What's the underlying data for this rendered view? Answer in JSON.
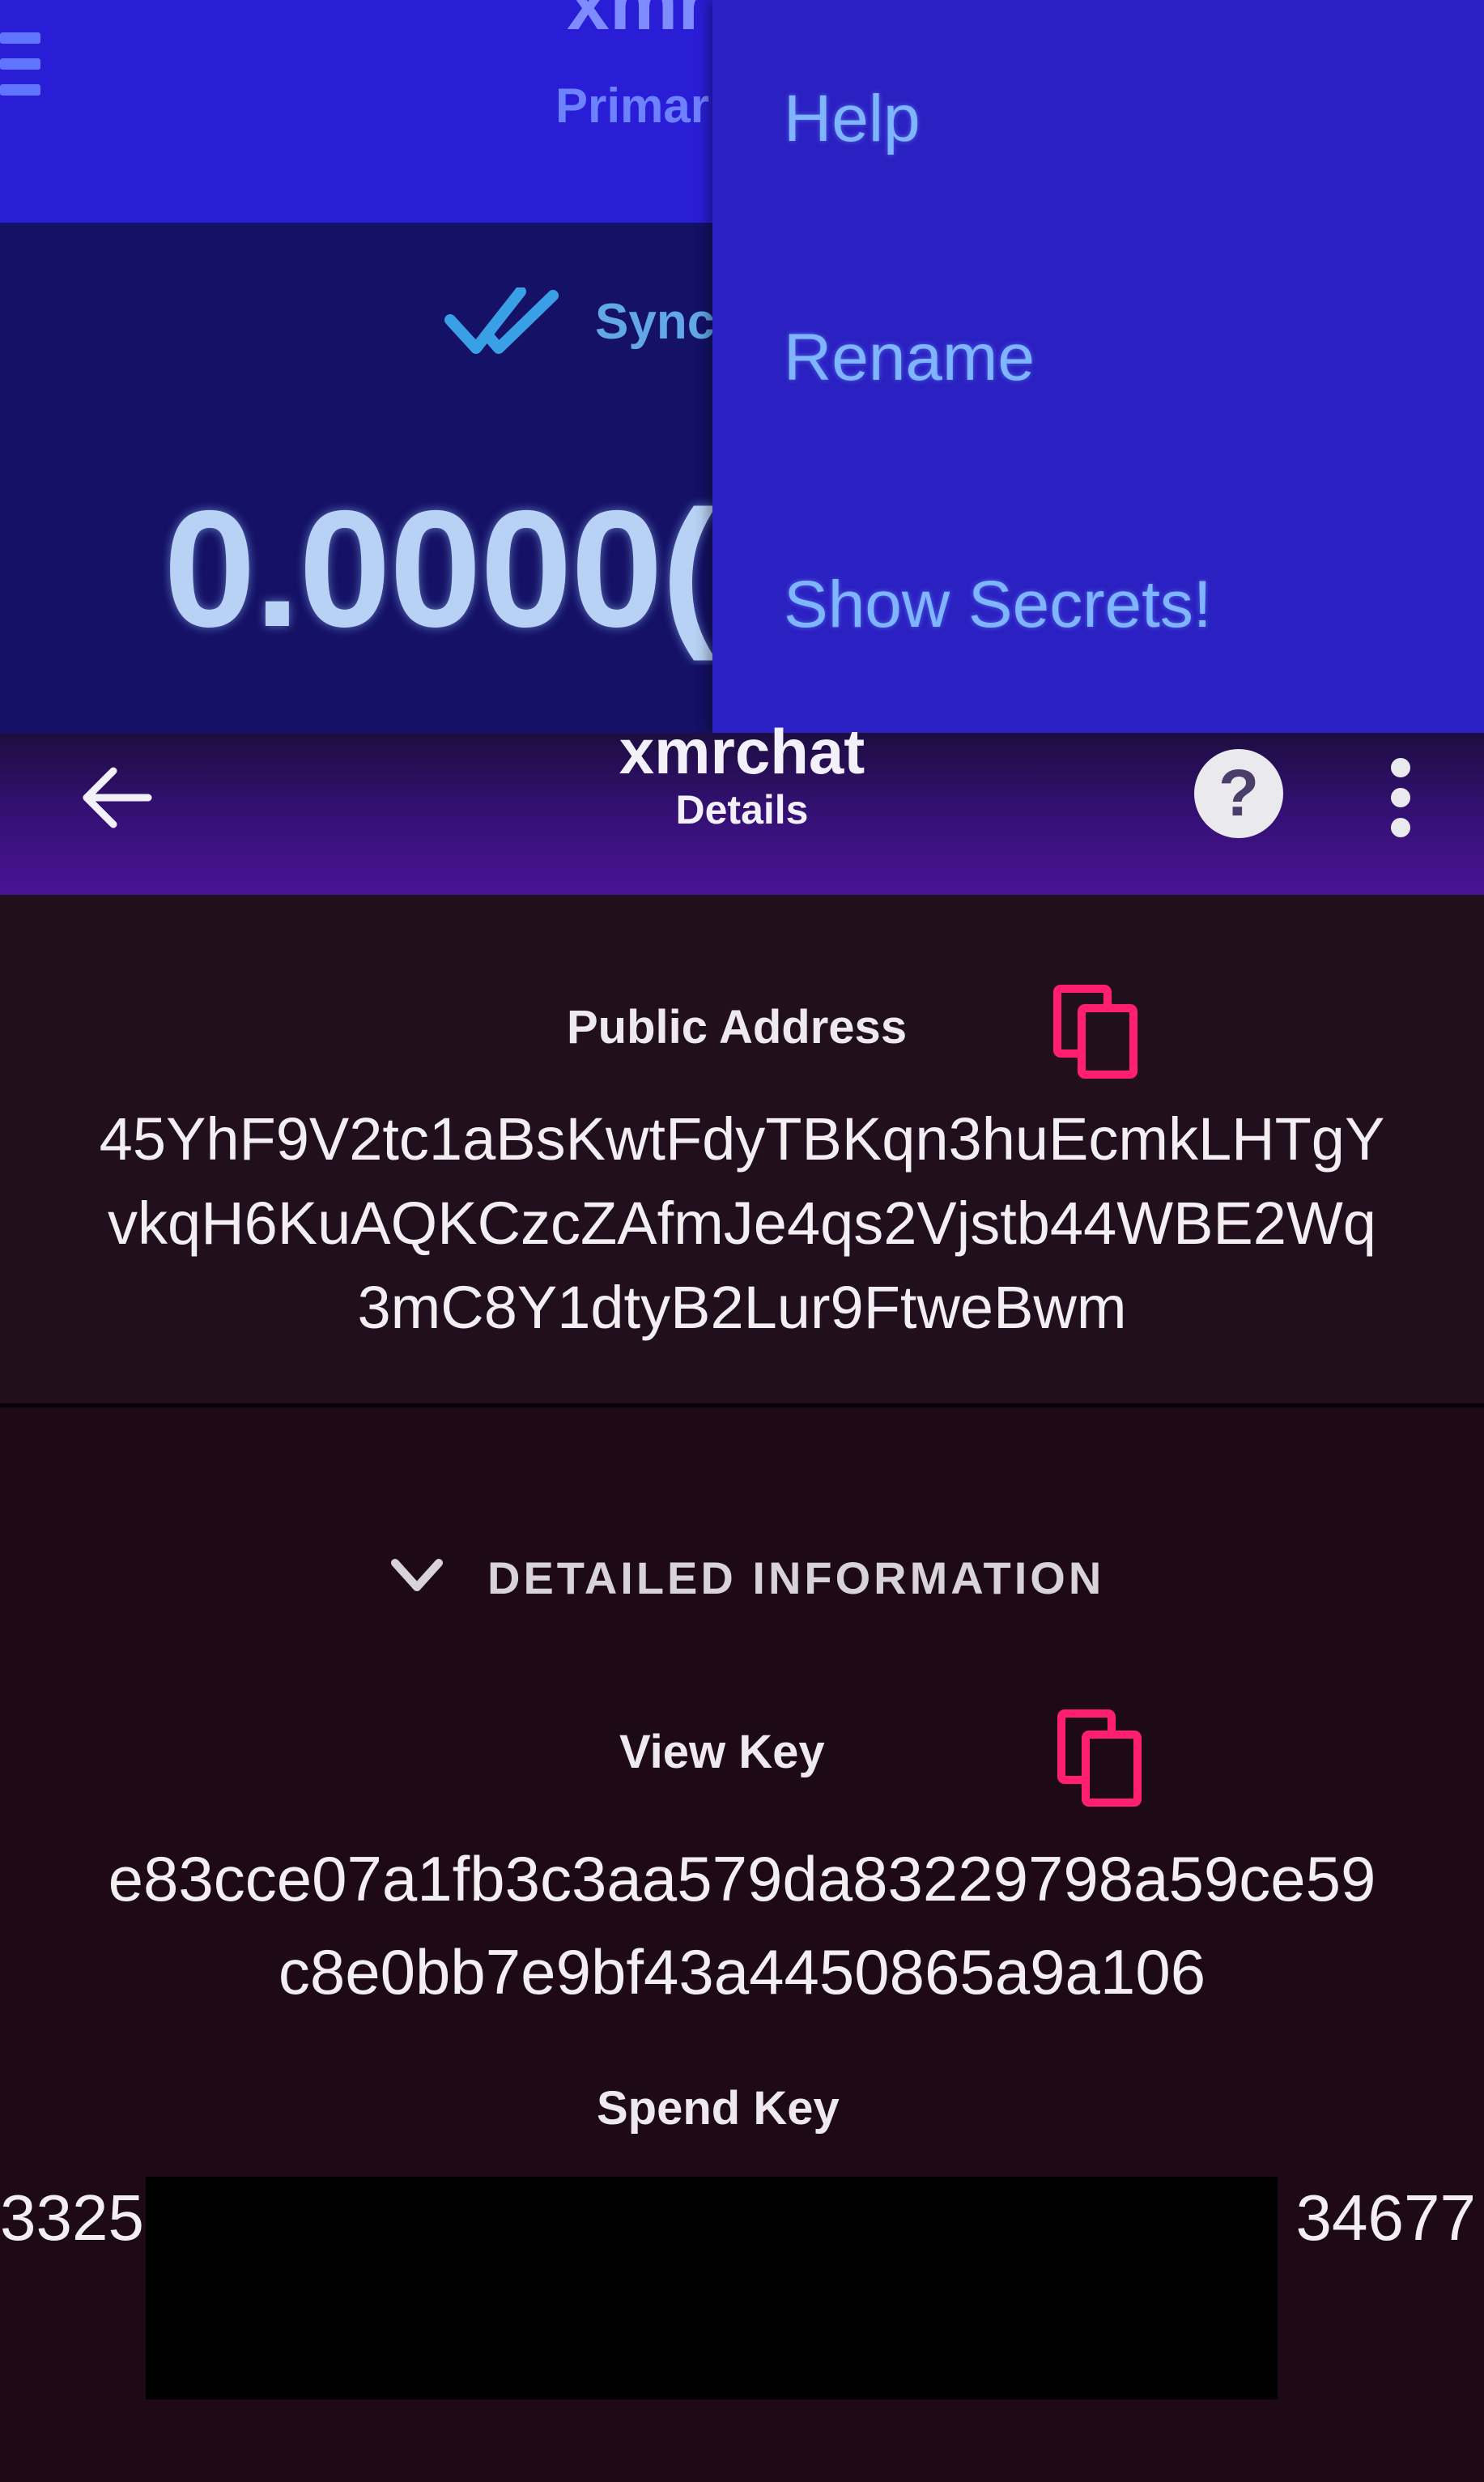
{
  "wallet_screen": {
    "title": "xmr",
    "subtitle": "Primar",
    "sync_label": "Sync",
    "balance": "0.0000(",
    "menu": {
      "items": [
        "Help",
        "Rename",
        "Show Secrets!"
      ]
    }
  },
  "details_screen": {
    "title": "xmrchat",
    "subtitle": "Details",
    "help_glyph": "?",
    "public_address": {
      "label": "Public Address",
      "lines": [
        "45YhF9V2tc1aBsKwtFdyTBKqn3huEcmkLHTgY",
        "vkqH6KuAQKCzcZAfmJe4qs2Vjstb44WBE2Wq",
        "3mC8Y1dtyB2Lur9FtweBwm"
      ]
    },
    "detailed_information_label": "DETAILED INFORMATION",
    "view_key": {
      "label": "View Key",
      "lines": [
        "e83cce07a1fb3c3aa579da83229798a59ce59",
        "c8e0bb7e9bf43a4450865a9a106"
      ]
    },
    "spend_key": {
      "label": "Spend Key",
      "visible_start": "3325",
      "visible_end": "34677"
    }
  },
  "colors": {
    "menu_bg": "#2b21c2",
    "app_bar_top": "#2a1dd6",
    "details_bg": "#210f1e",
    "copy_icon": "#ff1f6e"
  }
}
